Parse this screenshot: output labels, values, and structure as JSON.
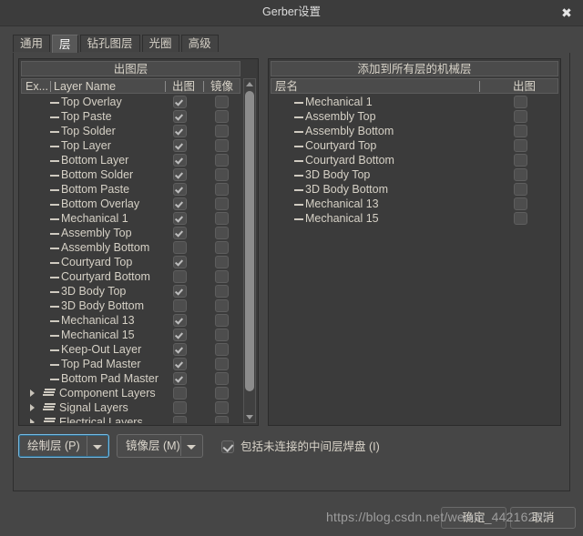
{
  "window": {
    "title": "Gerber设置",
    "close_icon": "close-icon"
  },
  "tabs": [
    {
      "label": "通用",
      "active": false
    },
    {
      "label": "层",
      "active": true
    },
    {
      "label": "钻孔图层",
      "active": false
    },
    {
      "label": "光圈",
      "active": false
    },
    {
      "label": "高级",
      "active": false
    }
  ],
  "left_panel": {
    "title": "出图层",
    "columns": {
      "extended": "Ex...",
      "name": "Layer Name",
      "plot": "出图",
      "mirror": "镜像"
    },
    "rows": [
      {
        "name": "Top Overlay",
        "plot": true,
        "mirror": false,
        "group": false
      },
      {
        "name": "Top Paste",
        "plot": true,
        "mirror": false,
        "group": false
      },
      {
        "name": "Top Solder",
        "plot": true,
        "mirror": false,
        "group": false
      },
      {
        "name": "Top Layer",
        "plot": true,
        "mirror": false,
        "group": false
      },
      {
        "name": "Bottom Layer",
        "plot": true,
        "mirror": false,
        "group": false
      },
      {
        "name": "Bottom Solder",
        "plot": true,
        "mirror": false,
        "group": false
      },
      {
        "name": "Bottom Paste",
        "plot": true,
        "mirror": false,
        "group": false
      },
      {
        "name": "Bottom Overlay",
        "plot": true,
        "mirror": false,
        "group": false
      },
      {
        "name": "Mechanical 1",
        "plot": true,
        "mirror": false,
        "group": false
      },
      {
        "name": "Assembly Top",
        "plot": true,
        "mirror": false,
        "group": false
      },
      {
        "name": "Assembly Bottom",
        "plot": false,
        "mirror": false,
        "group": false
      },
      {
        "name": "Courtyard Top",
        "plot": true,
        "mirror": false,
        "group": false
      },
      {
        "name": "Courtyard Bottom",
        "plot": false,
        "mirror": false,
        "group": false
      },
      {
        "name": "3D Body Top",
        "plot": true,
        "mirror": false,
        "group": false
      },
      {
        "name": "3D Body Bottom",
        "plot": false,
        "mirror": false,
        "group": false
      },
      {
        "name": "Mechanical 13",
        "plot": true,
        "mirror": false,
        "group": false
      },
      {
        "name": "Mechanical 15",
        "plot": true,
        "mirror": false,
        "group": false
      },
      {
        "name": "Keep-Out Layer",
        "plot": true,
        "mirror": false,
        "group": false
      },
      {
        "name": "Top Pad Master",
        "plot": true,
        "mirror": false,
        "group": false
      },
      {
        "name": "Bottom Pad Master",
        "plot": true,
        "mirror": false,
        "group": false
      },
      {
        "name": "Component Layers",
        "plot": false,
        "mirror": false,
        "group": true
      },
      {
        "name": "Signal Layers",
        "plot": false,
        "mirror": false,
        "group": true
      },
      {
        "name": "Electrical Layers",
        "plot": false,
        "mirror": false,
        "group": true
      }
    ]
  },
  "right_panel": {
    "title": "添加到所有层的机械层",
    "columns": {
      "name": "层名",
      "plot": "出图"
    },
    "rows": [
      {
        "name": "Mechanical 1",
        "plot": false
      },
      {
        "name": "Assembly Top",
        "plot": false
      },
      {
        "name": "Assembly Bottom",
        "plot": false
      },
      {
        "name": "Courtyard Top",
        "plot": false
      },
      {
        "name": "Courtyard Bottom",
        "plot": false
      },
      {
        "name": "3D Body Top",
        "plot": false
      },
      {
        "name": "3D Body Bottom",
        "plot": false
      },
      {
        "name": "Mechanical 13",
        "plot": false
      },
      {
        "name": "Mechanical 15",
        "plot": false
      }
    ]
  },
  "controls": {
    "plot_layers_label": "绘制层 (P)",
    "mirror_layers_label": "镜像层 (M)",
    "include_pads_label": "包括未连接的中间层焊盘 (I)",
    "include_pads_checked": true
  },
  "footer": {
    "ok_label": "确定",
    "cancel_label": "取消"
  },
  "watermark": {
    "text": "https://blog.csdn.net/weixin_44216265"
  },
  "colors": {
    "window_bg": "#464646",
    "panel_bg": "#3b3b3b",
    "header_bg": "#4b4b4b",
    "text": "#d8d3c8",
    "focus_accent": "#76b9e0",
    "scroll_thumb": "#8c8c8c"
  }
}
